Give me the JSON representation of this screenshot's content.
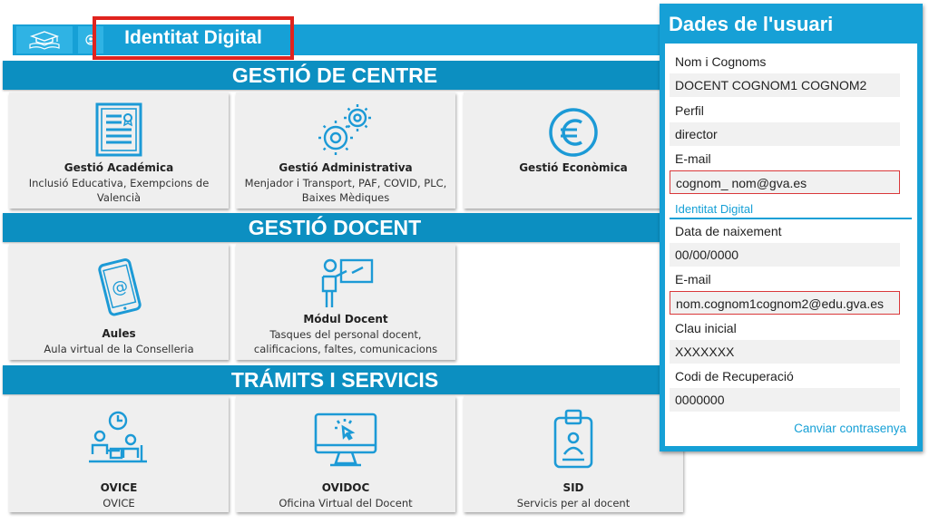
{
  "topbar": {
    "logo_icon": "graduation-cap-book-icon",
    "user_icon": "user-circle-icon",
    "identity_label": "Identitat Digital"
  },
  "sections": {
    "centre": "GESTIÓ DE CENTRE",
    "docent": "GESTIÓ DOCENT",
    "tramits": "TRÁMITS I SERVICIS"
  },
  "cards": {
    "academica": {
      "title": "Gestió Académica",
      "desc1": "Inclusió Educativa, Exempcions de",
      "desc2": "Valencià",
      "icon": "document-certificate-icon"
    },
    "administrativa": {
      "title": "Gestió Administrativa",
      "desc1": "Menjador i Transport, PAF, COVID, PLC,",
      "desc2": "Baixes Mèdiques",
      "icon": "gears-icon"
    },
    "economica": {
      "title": "Gestió Econòmica",
      "icon": "euro-icon"
    },
    "aules": {
      "title": "Aules",
      "desc1": "Aula virtual de la Conselleria",
      "icon": "tablet-at-icon"
    },
    "modul": {
      "title": "Módul Docent",
      "desc1": "Tasques del personal docent,",
      "desc2": "calificacions, faltes, comunicacions",
      "icon": "teacher-board-icon"
    },
    "ovice": {
      "title": "OVICE",
      "desc1": "OVICE",
      "icon": "office-clock-icon"
    },
    "ovidoc": {
      "title": "OVIDOC",
      "desc1": "Oficina Virtual del Docent",
      "icon": "monitor-cursor-icon"
    },
    "sid": {
      "title": "SID",
      "desc1": "Servicis per al docent",
      "icon": "id-badge-icon"
    }
  },
  "panel": {
    "title": "Dades de l'usuari",
    "name_label": "Nom i Cognoms",
    "name_value": "DOCENT COGNOM1 COGNOM2",
    "profile_label": "Perfil",
    "profile_value": "director",
    "email_label": "E-mail",
    "email_value": "cognom_ nom@gva.es",
    "identity_heading": "Identitat Digital",
    "birth_label": "Data de naixement",
    "birth_value": "00/00/0000",
    "email2_label": "E-mail",
    "email2_value": "nom.cognom1cognom2@edu.gva.es",
    "key_label": "Clau inicial",
    "key_value": "XXXXXXX",
    "recovery_label": "Codi de Recuperació",
    "recovery_value": "0000000",
    "change_password": "Canviar contrasenya"
  },
  "colors": {
    "accent": "#16a0d6",
    "section": "#0c8fc1",
    "highlight": "#e0231e"
  }
}
